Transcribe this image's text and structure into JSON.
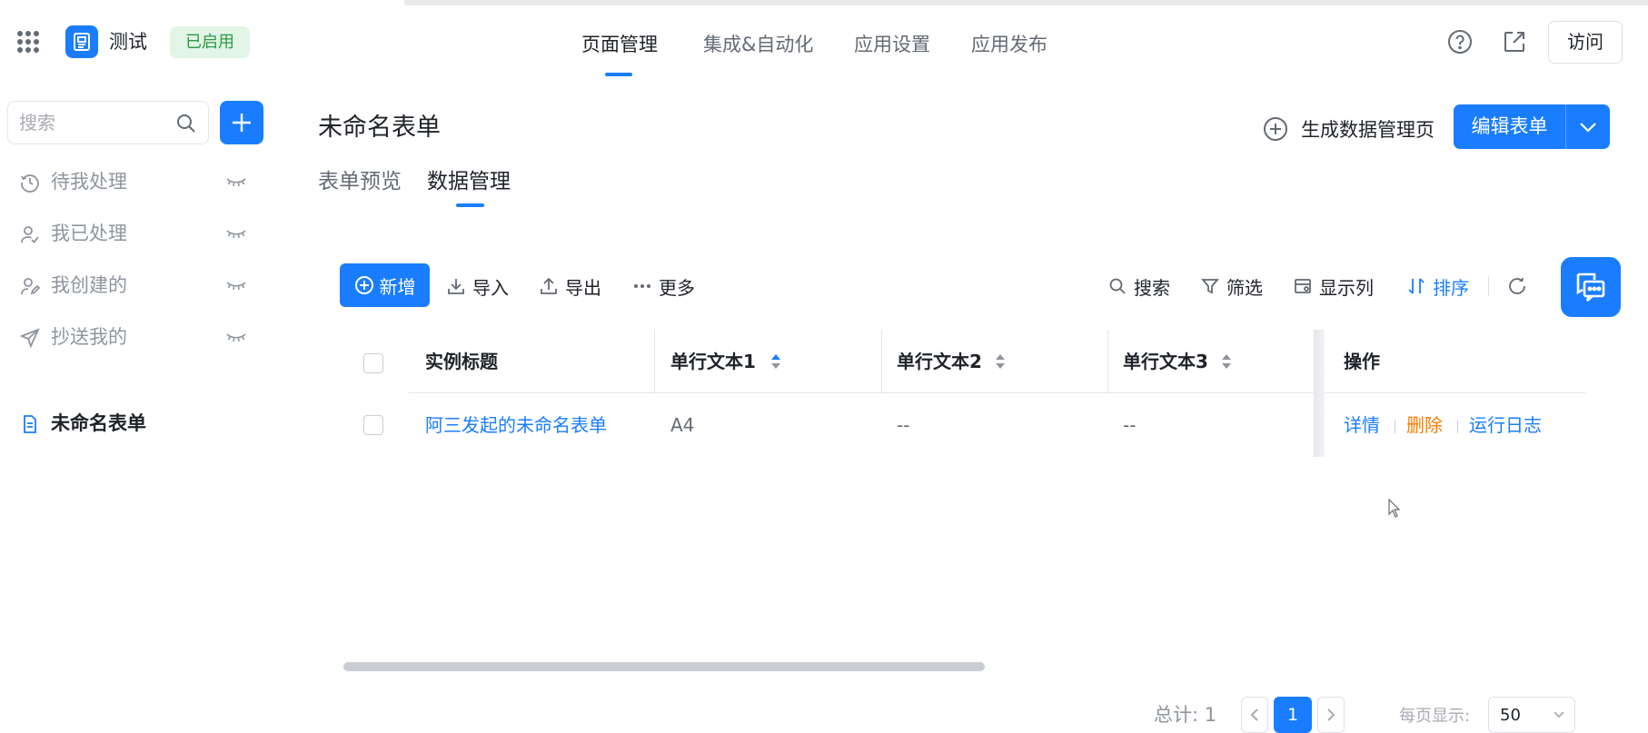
{
  "app": {
    "name": "测试",
    "status_badge": "已启用"
  },
  "top_nav": {
    "items": [
      {
        "label": "页面管理"
      },
      {
        "label": "集成&自动化"
      },
      {
        "label": "应用设置"
      },
      {
        "label": "应用发布"
      }
    ],
    "active_index": 0,
    "visit_label": "访问"
  },
  "sidebar": {
    "search_placeholder": "搜索",
    "items": [
      {
        "label": "待我处理",
        "icon": "clock-icon"
      },
      {
        "label": "我已处理",
        "icon": "user-check-icon"
      },
      {
        "label": "我创建的",
        "icon": "user-edit-icon"
      },
      {
        "label": "抄送我的",
        "icon": "send-icon"
      },
      {
        "label": "未命名表单",
        "icon": "document-icon",
        "active": true
      }
    ]
  },
  "main": {
    "title": "未命名表单",
    "generate_label": "生成数据管理页",
    "edit_label": "编辑表单",
    "tabs": [
      {
        "label": "表单预览"
      },
      {
        "label": "数据管理"
      }
    ],
    "active_tab": 1
  },
  "toolbar": {
    "new_label": "新增",
    "import_label": "导入",
    "export_label": "导出",
    "more_label": "更多",
    "search_label": "搜索",
    "filter_label": "筛选",
    "columns_label": "显示列",
    "sort_label": "排序"
  },
  "table": {
    "columns": [
      "实例标题",
      "单行文本1",
      "单行文本2",
      "单行文本3",
      "操作"
    ],
    "rows": [
      {
        "title": "阿三发起的未命名表单",
        "text1": "A4",
        "text2": "--",
        "text3": "--"
      }
    ],
    "actions": {
      "detail": "详情",
      "delete": "删除",
      "log": "运行日志"
    }
  },
  "pagination": {
    "total_label": "总计: 1",
    "current_page": "1",
    "per_page_label": "每页显示:",
    "per_page_value": "50"
  },
  "colors": {
    "primary": "#1a7dff",
    "danger": "#ff7d00",
    "success_bg": "#e2f5e6",
    "success_text": "#2a9b45"
  }
}
